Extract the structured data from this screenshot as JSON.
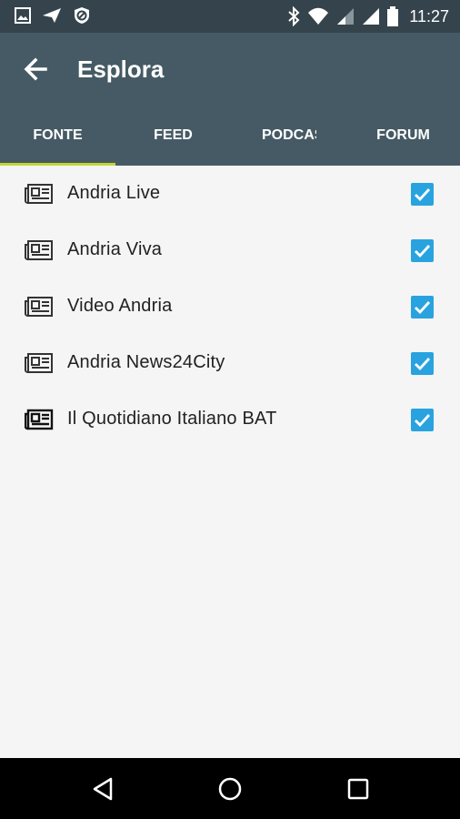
{
  "status_bar": {
    "time": "11:27",
    "left_icons": [
      "image-icon",
      "send-icon",
      "blocked-icon"
    ],
    "right_icons": [
      "bluetooth-icon",
      "wifi-icon",
      "signal-icon",
      "signal-icon",
      "battery-icon"
    ]
  },
  "app_bar": {
    "title": "Esplora",
    "back_icon": "arrow-left-icon"
  },
  "tabs": [
    {
      "label": "FONTE",
      "selected": true
    },
    {
      "label": "FEED",
      "selected": false
    },
    {
      "label": "PODCAST",
      "selected": false
    },
    {
      "label": "FORUM",
      "selected": false
    }
  ],
  "sources": [
    {
      "name": "Andria Live",
      "checked": true
    },
    {
      "name": "Andria Viva",
      "checked": true
    },
    {
      "name": "Video Andria",
      "checked": true
    },
    {
      "name": "Andria News24City",
      "checked": true
    },
    {
      "name": "Il Quotidiano Italiano BAT",
      "checked": true
    }
  ],
  "colors": {
    "status_bar": "#35444c",
    "app_bar": "#455a64",
    "tab_indicator": "#c6d435",
    "checkbox": "#29a3df",
    "background": "#f5f5f5"
  },
  "nav_bar": {
    "buttons": [
      "back-triangle-icon",
      "home-circle-icon",
      "recents-square-icon"
    ]
  }
}
